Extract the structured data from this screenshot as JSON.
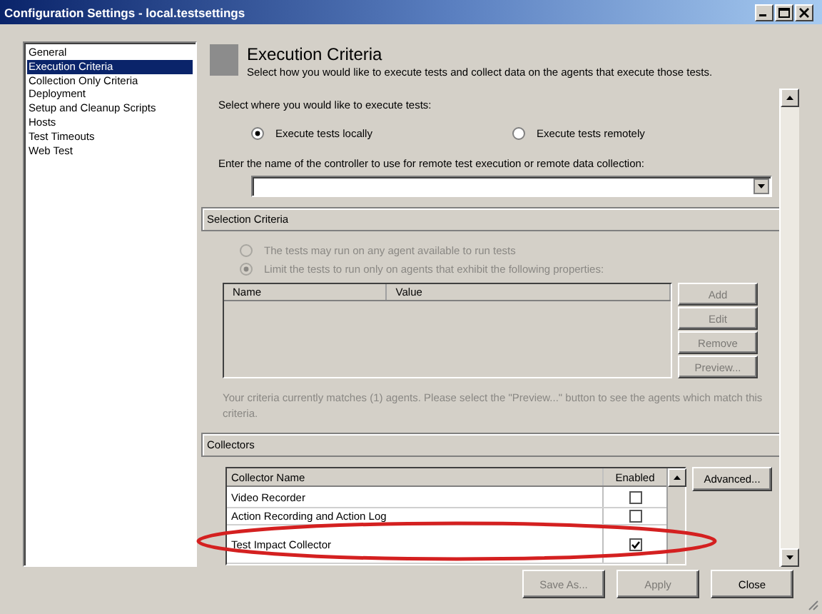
{
  "window": {
    "title": "Configuration Settings - local.testsettings"
  },
  "sidebar": {
    "items": [
      {
        "label": "General",
        "selected": false
      },
      {
        "label": "Execution Criteria",
        "selected": true
      },
      {
        "label": "Collection Only Criteria",
        "selected": false
      },
      {
        "label": "Deployment",
        "selected": false
      },
      {
        "label": "Setup and Cleanup Scripts",
        "selected": false
      },
      {
        "label": "Hosts",
        "selected": false
      },
      {
        "label": "Test Timeouts",
        "selected": false
      },
      {
        "label": "Web Test",
        "selected": false
      }
    ]
  },
  "header": {
    "title": "Execution Criteria",
    "description": "Select how you would like to execute tests and collect data on the agents that execute those tests."
  },
  "execution": {
    "prompt": "Select where you would like to execute tests:",
    "options": [
      {
        "label": "Execute tests locally",
        "selected": true
      },
      {
        "label": "Execute tests remotely",
        "selected": false
      }
    ],
    "controller_prompt": "Enter the name of the controller to use for remote test execution or remote data collection:"
  },
  "selection_criteria": {
    "title": "Selection Criteria",
    "options": [
      {
        "label": "The tests may run on any agent available to run tests",
        "selected": false,
        "disabled": true
      },
      {
        "label": "Limit the tests to run only on agents that exhibit the following properties:",
        "selected": true,
        "disabled": true
      }
    ],
    "table": {
      "columns": [
        "Name",
        "Value"
      ]
    },
    "buttons": [
      {
        "label": "Add",
        "disabled": true
      },
      {
        "label": "Edit",
        "disabled": true
      },
      {
        "label": "Remove",
        "disabled": true
      },
      {
        "label": "Preview...",
        "disabled": true
      }
    ],
    "note": "Your criteria currently matches (1) agents.  Please select the \"Preview...\" button to see the agents which match this criteria."
  },
  "collectors": {
    "title": "Collectors",
    "columns": [
      "Collector Name",
      "Enabled"
    ],
    "rows": [
      {
        "name": "Video Recorder",
        "enabled": false
      },
      {
        "name": "Action Recording and Action Log",
        "enabled": false
      },
      {
        "name": "Test Impact Collector",
        "enabled": true
      }
    ],
    "advanced_button": "Advanced..."
  },
  "footer_buttons": [
    {
      "label": "Save As...",
      "disabled": true
    },
    {
      "label": "Apply",
      "disabled": true
    },
    {
      "label": "Close",
      "disabled": false
    }
  ],
  "annotation": {
    "kind": "ellipse",
    "color": "#d42020"
  }
}
